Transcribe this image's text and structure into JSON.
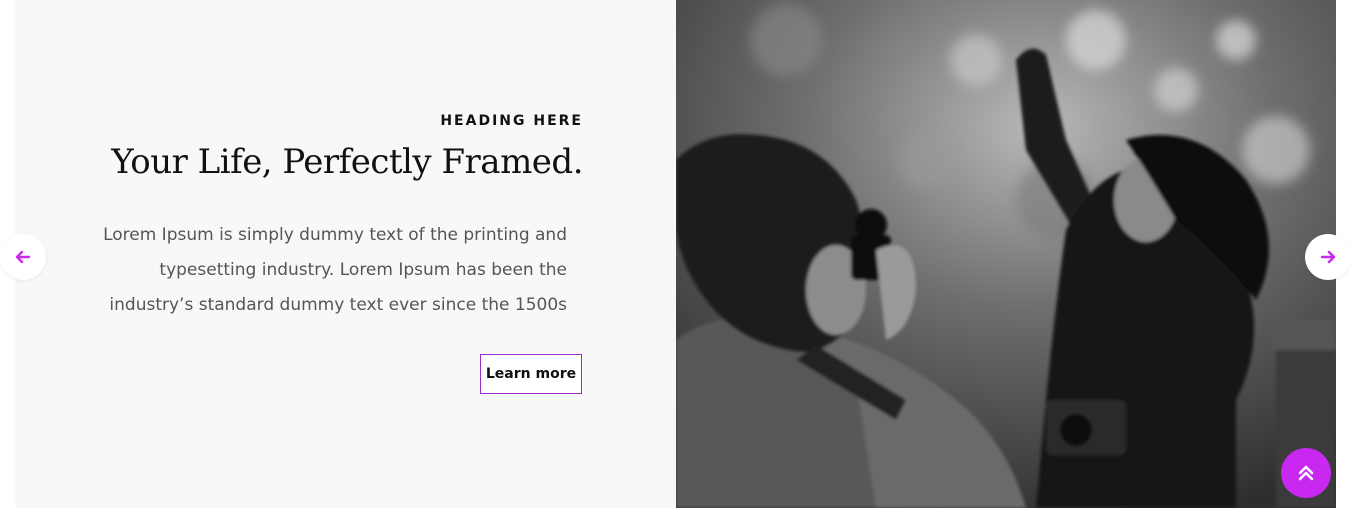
{
  "slide": {
    "eyebrow": "HEADING HERE",
    "title": "Your Life, Perfectly Framed.",
    "body": "Lorem Ipsum is simply dummy text of the printing and typesetting industry. Lorem Ipsum has been the industry’s standard dummy text ever since the 1500s",
    "cta_label": "Learn more",
    "image_alt": "black and white photo of two photographers"
  },
  "controls": {
    "prev_icon": "arrow-left-icon",
    "next_icon": "arrow-right-icon",
    "scroll_top_icon": "double-chevron-up-icon"
  },
  "colors": {
    "accent": "#c928f0",
    "button_border": "#9a2ecb",
    "panel_bg": "#f8f8f8",
    "text_dark": "#111111",
    "text_body": "#555555"
  }
}
